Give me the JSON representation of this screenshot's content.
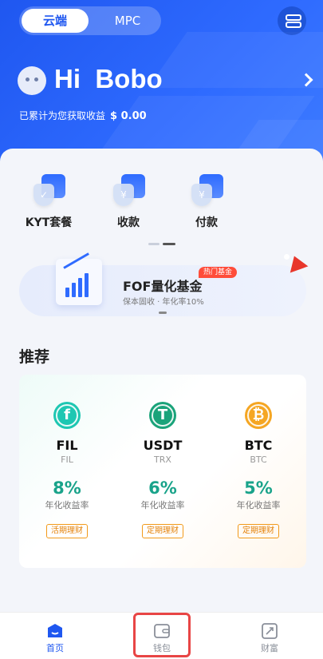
{
  "header": {
    "tab_cloud": "云端",
    "tab_mpc": "MPC",
    "greeting": "Hi  Bobo",
    "earnings_label": "已累计为您获取收益",
    "earnings_value": "$ 0.00"
  },
  "quick_actions": [
    {
      "label": "KYT套餐",
      "icon": "kyt-package-icon",
      "glyph": "✓"
    },
    {
      "label": "收款",
      "icon": "receive-icon",
      "glyph": "¥"
    },
    {
      "label": "付款",
      "icon": "pay-icon",
      "glyph": "¥"
    }
  ],
  "banner": {
    "title": "FOF量化基金",
    "subtitle": "保本固收 · 年化率10%",
    "badge": "热门基金"
  },
  "recommend": {
    "title": "推荐",
    "items": [
      {
        "name": "FIL",
        "chain": "FIL",
        "glyph": "f",
        "coin_color": "#1ec7b2",
        "rate": "8%",
        "rate_label": "年化收益率",
        "tag": "活期理财"
      },
      {
        "name": "USDT",
        "chain": "TRX",
        "glyph": "T",
        "coin_color": "#1aa37a",
        "rate": "6%",
        "rate_label": "年化收益率",
        "tag": "定期理财"
      },
      {
        "name": "BTC",
        "chain": "BTC",
        "glyph": "₿",
        "coin_color": "#f5a623",
        "rate": "5%",
        "rate_label": "年化收益率",
        "tag": "定期理财"
      }
    ]
  },
  "tabbar": {
    "items": [
      {
        "label": "首页",
        "active": true
      },
      {
        "label": "钱包",
        "active": false
      },
      {
        "label": "财富",
        "active": false
      }
    ]
  },
  "colors": {
    "brand": "#2f6bff",
    "rate_green": "#19a38a",
    "tag_orange": "#e4820a",
    "highlight": "#e84545"
  }
}
